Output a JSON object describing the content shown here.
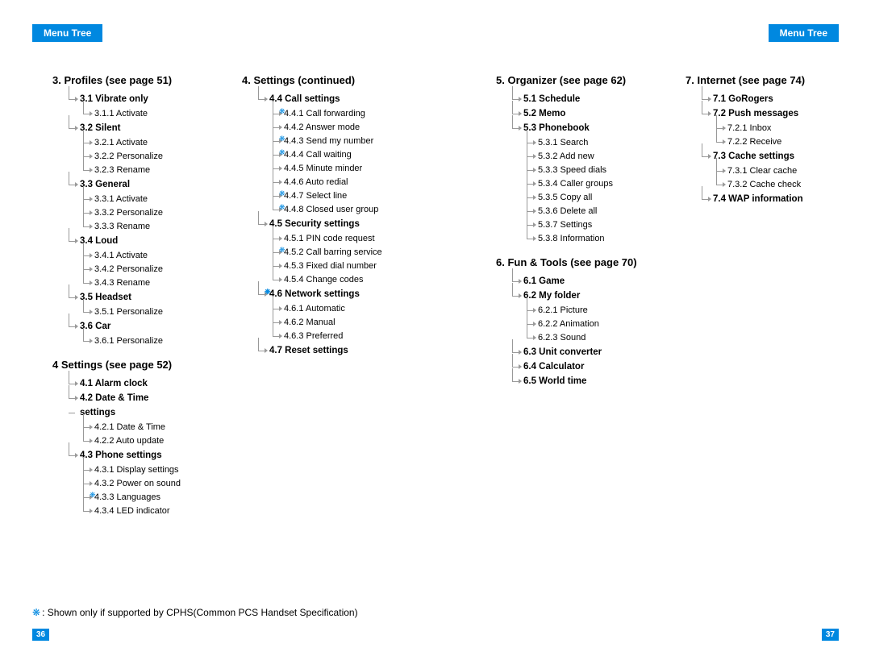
{
  "header": {
    "left": "Menu Tree",
    "right": "Menu Tree"
  },
  "col1": [
    {
      "type": "h",
      "text": "3. Profiles (see page 51)"
    },
    {
      "type": "l1",
      "text": "3.1 Vibrate only"
    },
    {
      "type": "l2",
      "text": "3.1.1 Activate"
    },
    {
      "type": "l1",
      "text": "3.2 Silent"
    },
    {
      "type": "l2",
      "text": "3.2.1 Activate"
    },
    {
      "type": "l2",
      "text": "3.2.2 Personalize"
    },
    {
      "type": "l2",
      "text": "3.2.3 Rename"
    },
    {
      "type": "l1",
      "text": "3.3 General"
    },
    {
      "type": "l2",
      "text": "3.3.1 Activate"
    },
    {
      "type": "l2",
      "text": "3.3.2 Personalize"
    },
    {
      "type": "l2",
      "text": "3.3.3 Rename"
    },
    {
      "type": "l1",
      "text": "3.4 Loud"
    },
    {
      "type": "l2",
      "text": "3.4.1 Activate"
    },
    {
      "type": "l2",
      "text": "3.4.2 Personalize"
    },
    {
      "type": "l2",
      "text": "3.4.3 Rename"
    },
    {
      "type": "l1",
      "text": "3.5 Headset"
    },
    {
      "type": "l2",
      "text": "3.5.1 Personalize"
    },
    {
      "type": "l1",
      "text": "3.6 Car"
    },
    {
      "type": "l2",
      "text": "3.6.1 Personalize"
    },
    {
      "type": "h",
      "text": "4  Settings (see page 52)"
    },
    {
      "type": "l1",
      "text": "4.1 Alarm clock"
    },
    {
      "type": "l1",
      "text": "4.2 Date & Time"
    },
    {
      "type": "l1cont",
      "text": "settings"
    },
    {
      "type": "l2",
      "text": "4.2.1 Date & Time"
    },
    {
      "type": "l2",
      "text": "4.2.2 Auto update"
    },
    {
      "type": "l1",
      "text": "4.3 Phone settings"
    },
    {
      "type": "l2",
      "text": "4.3.1 Display settings"
    },
    {
      "type": "l2",
      "text": "4.3.2 Power on sound"
    },
    {
      "type": "l2",
      "text": "4.3.3 Languages",
      "star": true
    },
    {
      "type": "l2",
      "text": "4.3.4 LED indicator"
    }
  ],
  "col2": [
    {
      "type": "h",
      "text": "4. Settings (continued)"
    },
    {
      "type": "l1",
      "text": "4.4 Call settings"
    },
    {
      "type": "l2",
      "text": "4.4.1 Call forwarding",
      "star": true
    },
    {
      "type": "l2",
      "text": "4.4.2 Answer mode"
    },
    {
      "type": "l2",
      "text": "4.4.3 Send my number",
      "star": true
    },
    {
      "type": "l2",
      "text": "4.4.4 Call waiting",
      "star": true
    },
    {
      "type": "l2",
      "text": "4.4.5 Minute minder"
    },
    {
      "type": "l2",
      "text": "4.4.6 Auto redial"
    },
    {
      "type": "l2",
      "text": "4.4.7 Select line",
      "star": true
    },
    {
      "type": "l2",
      "text": "4.4.8 Closed user group",
      "star": true
    },
    {
      "type": "l1",
      "text": "4.5 Security settings"
    },
    {
      "type": "l2",
      "text": "4.5.1 PIN code request"
    },
    {
      "type": "l2",
      "text": "4.5.2 Call barring service",
      "star": true
    },
    {
      "type": "l2",
      "text": "4.5.3 Fixed dial number"
    },
    {
      "type": "l2",
      "text": "4.5.4 Change codes"
    },
    {
      "type": "l1",
      "text": "4.6 Network settings",
      "star": true
    },
    {
      "type": "l2",
      "text": "4.6.1 Automatic"
    },
    {
      "type": "l2",
      "text": "4.6.2 Manual"
    },
    {
      "type": "l2",
      "text": "4.6.3 Preferred"
    },
    {
      "type": "l1",
      "text": "4.7 Reset settings"
    }
  ],
  "col3": [
    {
      "type": "h",
      "text": "5. Organizer (see page 62)"
    },
    {
      "type": "l1",
      "text": "5.1 Schedule"
    },
    {
      "type": "l1",
      "text": "5.2 Memo"
    },
    {
      "type": "l1",
      "text": "5.3 Phonebook"
    },
    {
      "type": "l2",
      "text": "5.3.1 Search"
    },
    {
      "type": "l2",
      "text": "5.3.2 Add new"
    },
    {
      "type": "l2",
      "text": "5.3.3 Speed dials"
    },
    {
      "type": "l2",
      "text": "5.3.4 Caller groups"
    },
    {
      "type": "l2",
      "text": "5.3.5 Copy all"
    },
    {
      "type": "l2",
      "text": "5.3.6 Delete all"
    },
    {
      "type": "l2",
      "text": "5.3.7 Settings"
    },
    {
      "type": "l2",
      "text": "5.3.8 Information"
    },
    {
      "type": "h",
      "text": "6. Fun & Tools (see page 70)"
    },
    {
      "type": "l1",
      "text": "6.1 Game"
    },
    {
      "type": "l1",
      "text": "6.2 My folder"
    },
    {
      "type": "l2",
      "text": "6.2.1 Picture"
    },
    {
      "type": "l2",
      "text": "6.2.2 Animation"
    },
    {
      "type": "l2",
      "text": "6.2.3 Sound"
    },
    {
      "type": "l1",
      "text": "6.3 Unit converter"
    },
    {
      "type": "l1",
      "text": "6.4 Calculator"
    },
    {
      "type": "l1",
      "text": "6.5 World time"
    }
  ],
  "col4": [
    {
      "type": "h",
      "text": "7. Internet (see page 74)"
    },
    {
      "type": "l1",
      "text": "7.1 GoRogers"
    },
    {
      "type": "l1",
      "text": "7.2 Push messages"
    },
    {
      "type": "l2",
      "text": "7.2.1 Inbox"
    },
    {
      "type": "l2",
      "text": "7.2.2 Receive"
    },
    {
      "type": "l1",
      "text": "7.3 Cache settings"
    },
    {
      "type": "l2",
      "text": "7.3.1 Clear cache"
    },
    {
      "type": "l2",
      "text": "7.3.2 Cache check"
    },
    {
      "type": "l1",
      "text": "7.4 WAP information"
    }
  ],
  "footnote": {
    "star": "❋",
    "text": ": Shown only if supported by CPHS(Common PCS Handset Specification)"
  },
  "footer": {
    "left": "36",
    "right": "37"
  }
}
